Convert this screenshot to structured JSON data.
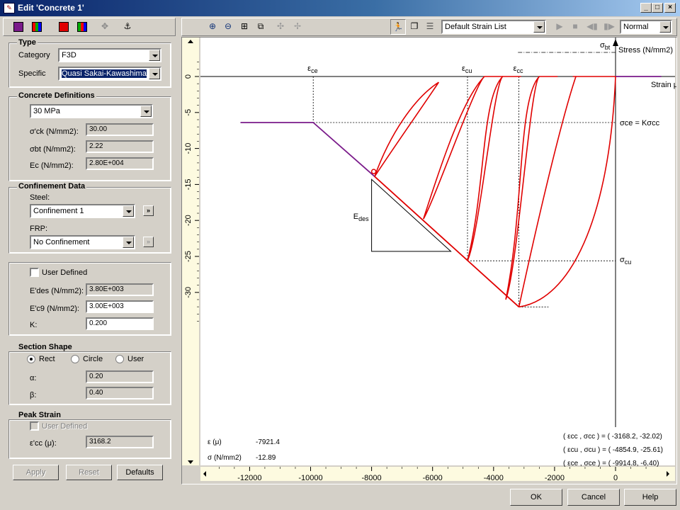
{
  "window": {
    "title": "Edit 'Concrete 1'"
  },
  "left_toolbar": {
    "icons": [
      "purple-square-icon",
      "color-grid-icon",
      "red-square-icon",
      "color-grid-icon",
      "move-cross-icon",
      "anchor-icon"
    ]
  },
  "type": {
    "title": "Type",
    "category_label": "Category",
    "category_value": "F3D",
    "specific_label": "Specific",
    "specific_value": "Quasi Sakai-Kawashima"
  },
  "concrete_defs": {
    "title": "Concrete Definitions",
    "grade": "30 MPa",
    "fck_label": "σ'ck (N/mm2):",
    "fck_value": "30.00",
    "fbt_label": "σbt (N/mm2):",
    "fbt_value": "2.22",
    "ec_label": "Ec (N/mm2):",
    "ec_value": "2.80E+004"
  },
  "confinement": {
    "title": "Confinement Data",
    "steel_label": "Steel:",
    "steel_value": "Confinement 1",
    "frp_label": "FRP:",
    "frp_value": "No Confinement"
  },
  "user_defined": {
    "checkbox_label": "User Defined",
    "edes_label": "E'des (N/mm2):",
    "edes_value": "3.80E+003",
    "ec9_label": "E'c9 (N/mm2):",
    "ec9_value": "3.00E+003",
    "k_label": "K:",
    "k_value": "0.200"
  },
  "section_shape": {
    "title": "Section Shape",
    "rect_label": "Rect",
    "circle_label": "Circle",
    "user_label": "User",
    "alpha_label": "α:",
    "alpha_value": "0.20",
    "beta_label": "β:",
    "beta_value": "0.40"
  },
  "peak_strain": {
    "title": "Peak Strain",
    "checkbox_label": "User Defined",
    "ecc_label": "ε'cc (μ):",
    "ecc_value": "3168.2"
  },
  "left_buttons": {
    "apply": "Apply",
    "reset": "Reset",
    "defaults": "Defaults"
  },
  "chart_toolbar": {
    "icons": [
      "zoom-in-icon",
      "zoom-out-icon",
      "zoom-fit-icon",
      "zoom-window-icon",
      "pan-icon",
      "pan-alt-icon",
      "runner-icon",
      "copy-icon",
      "list-icon"
    ],
    "strain_list": "Default Strain List",
    "mode": "Normal",
    "playback_icons": [
      "play-icon",
      "stop-icon",
      "step-back-icon",
      "step-forward-icon"
    ]
  },
  "chart_data": {
    "type": "line",
    "xlabel": "Strain μ",
    "ylabel": "Stress (N/mm2)",
    "xlim": [
      -13500,
      1500
    ],
    "ylim": [
      -34.5,
      3
    ],
    "x_ticks": [
      -12000,
      -10000,
      -8000,
      -6000,
      -4000,
      -2000,
      0
    ],
    "x_tick_labels": [
      "-12000",
      "-10000",
      "-8000",
      "-6000",
      "-4000",
      "-2000",
      "0"
    ],
    "y_ticks": [
      0,
      -5,
      -10,
      -15,
      -20,
      -25,
      -30
    ],
    "y_tick_labels": [
      "0",
      "-5",
      "-10",
      "-15",
      "-20",
      "-25",
      "-30"
    ],
    "grid": false,
    "annotations": {
      "sigma_bt": "σbt",
      "eps_ce": "εce",
      "eps_cu": "εcu",
      "eps_cc": "εcc",
      "sigma_ce": "σce = Kσcc",
      "sigma_cu": "σcu",
      "edes": "Edes"
    },
    "readout": {
      "eps_label": "ε (μ)",
      "eps_value": "-7921.4",
      "sigma_label": "σ (N/mm2)",
      "sigma_value": "-12.89"
    },
    "points_text": [
      "( εcc , σcc ) = ( -3168.2, -32.02)",
      "( εcu , σcu ) = ( -4854.9, -25.61)",
      "( εce , σce ) = ( -9914.8,   -6.40)"
    ],
    "envelope_purple": {
      "x": [
        -12300,
        -9914.8,
        -7900
      ],
      "y": [
        -6.4,
        -6.4,
        -13.9
      ]
    },
    "envelope_red": {
      "x": [
        -7900,
        -3168.2,
        -4854.9,
        -3168.2,
        0
      ],
      "y": [
        -13.9,
        -32.02,
        -25.61,
        -32.02,
        0
      ]
    },
    "tension_line": {
      "x": [
        0,
        1500
      ],
      "y": [
        0,
        0
      ]
    },
    "key_points": {
      "ecc": -3168.2,
      "scc": -32.02,
      "ecu": -4854.9,
      "scu": -25.61,
      "ece": -9914.8,
      "sce": -6.4
    },
    "triangle": {
      "x": [
        -8000,
        -8000,
        -5400
      ],
      "y": [
        -14.3,
        -24.3,
        -24.3
      ]
    }
  },
  "dialog_buttons": {
    "ok": "OK",
    "cancel": "Cancel",
    "help": "Help"
  }
}
